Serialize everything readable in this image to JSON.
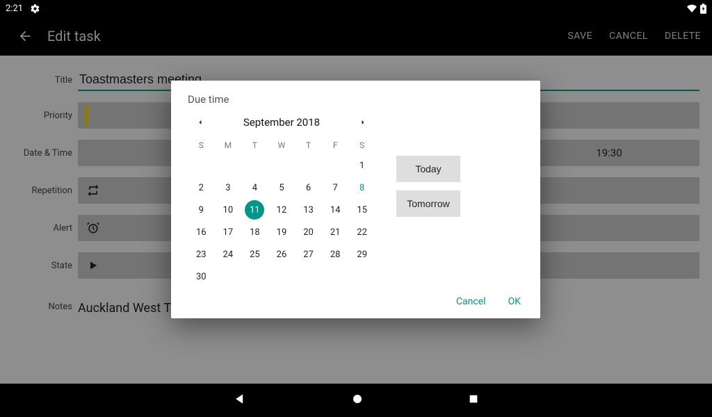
{
  "status": {
    "time": "2:21"
  },
  "appbar": {
    "title": "Edit task",
    "save": "SAVE",
    "cancel": "CANCEL",
    "delete": "DELETE"
  },
  "form": {
    "labels": {
      "title": "Title",
      "priority": "Priority",
      "datetime": "Date & Time",
      "repetition": "Repetition",
      "alert": "Alert",
      "state": "State",
      "notes": "Notes"
    },
    "title_value": "Toastmasters meeting",
    "time_value": "19:30",
    "notes_value": "Auckland West Toastmasters"
  },
  "dialog": {
    "title": "Due time",
    "month_label": "September 2018",
    "dow": [
      "S",
      "M",
      "T",
      "W",
      "T",
      "F",
      "S"
    ],
    "today_btn": "Today",
    "tomorrow_btn": "Tomorrow",
    "cancel": "Cancel",
    "ok": "OK",
    "selected_day": 11,
    "highlight_day": 8,
    "first_weekday": 6,
    "days_in_month": 30
  }
}
